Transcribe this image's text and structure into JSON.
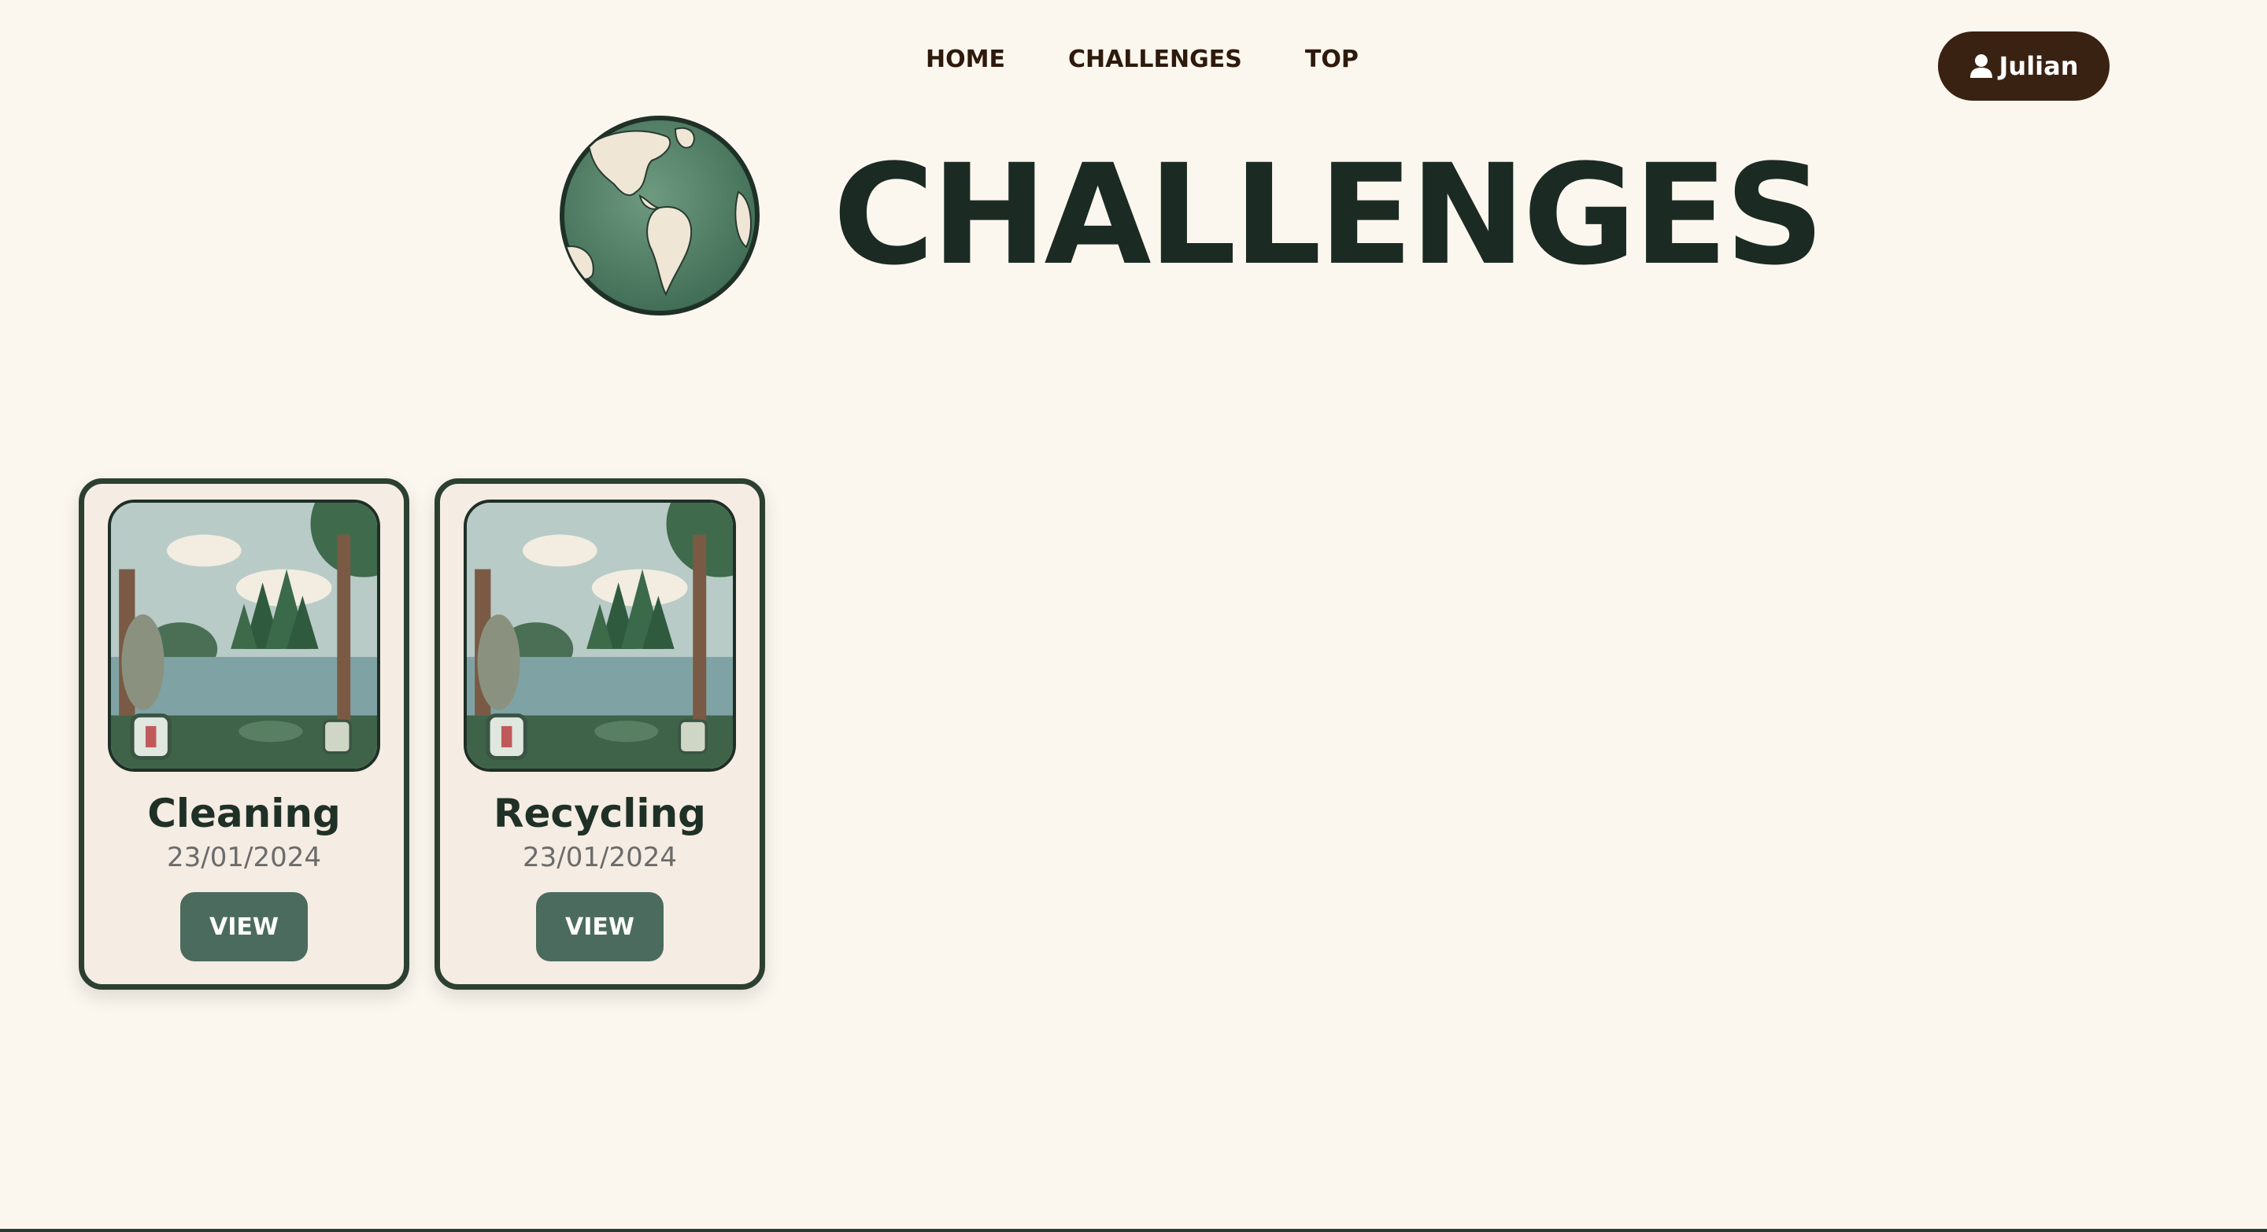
{
  "nav": {
    "items": [
      {
        "label": "HOME"
      },
      {
        "label": "CHALLENGES"
      },
      {
        "label": "TOP"
      }
    ]
  },
  "user": {
    "name": "Julian",
    "icon": "user-icon"
  },
  "hero": {
    "title": "CHALLENGES",
    "logo": "globe-icon"
  },
  "cards": [
    {
      "title": "Cleaning",
      "date": "23/01/2024",
      "button": "VIEW",
      "image": "forest-lake-illustration"
    },
    {
      "title": "Recycling",
      "date": "23/01/2024",
      "button": "VIEW",
      "image": "forest-lake-illustration"
    }
  ],
  "colors": {
    "background": "#fcf7ee",
    "primary_text": "#1b2b24",
    "nav_text": "#2e1a0d",
    "user_button": "#3a2212",
    "card_border": "#2c4032",
    "card_background": "#f5ece3",
    "view_button": "#4b6b5e"
  }
}
